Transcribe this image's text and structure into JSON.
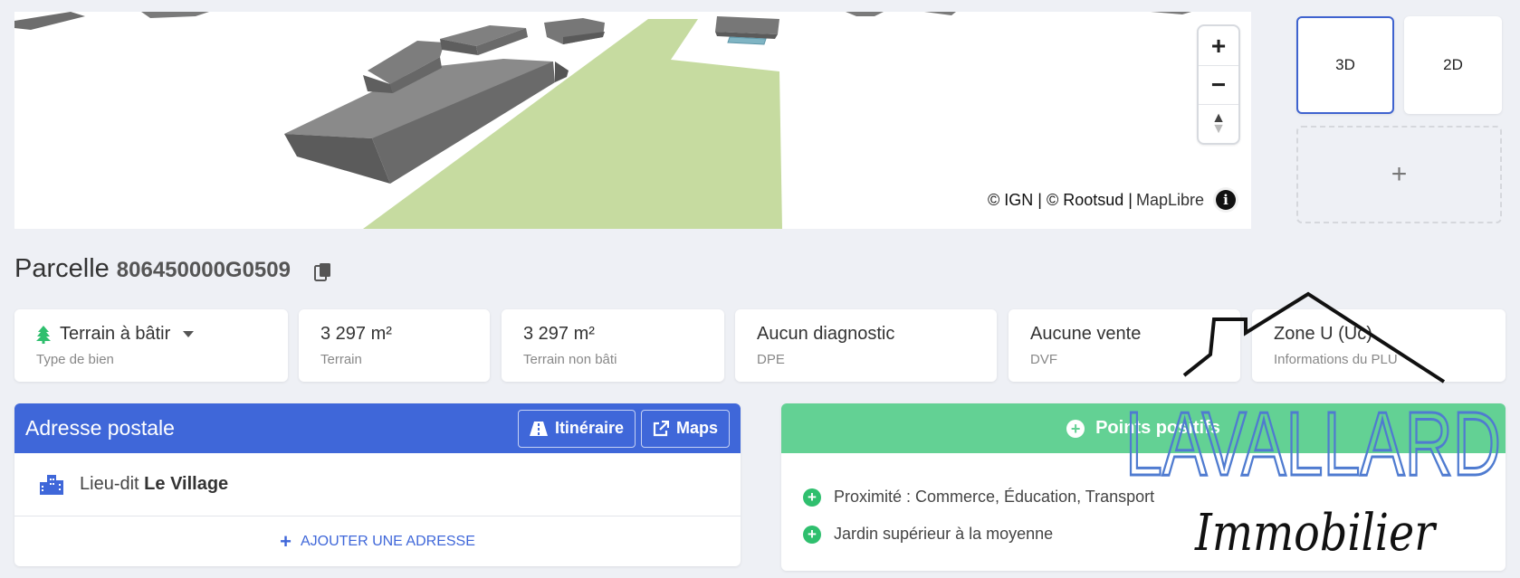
{
  "map": {
    "zoom_in": "+",
    "zoom_out": "−",
    "compass": "▲",
    "attribution_ign": "© IGN | © Rootsud |",
    "attribution_lib": "MapLibre",
    "info": "i"
  },
  "views": {
    "v3d": "3D",
    "v2d": "2D",
    "add": "+"
  },
  "parcel": {
    "prefix": "Parcelle",
    "id": "806450000G0509"
  },
  "cards": [
    {
      "value": "Terrain à bâtir",
      "label": "Type de bien"
    },
    {
      "value": "3 297 m²",
      "label": "Terrain"
    },
    {
      "value": "3 297 m²",
      "label": "Terrain non bâti"
    },
    {
      "value": "Aucun diagnostic",
      "label": "DPE"
    },
    {
      "value": "Aucune vente",
      "label": "DVF"
    },
    {
      "value": "Zone U (Uc)",
      "label": "Informations du PLU"
    }
  ],
  "address": {
    "title": "Adresse postale",
    "itinerary": "Itinéraire",
    "maps": "Maps",
    "prefix": "Lieu-dit",
    "place": "Le Village",
    "add_label": "AJOUTER UNE ADRESSE"
  },
  "positives": {
    "title": "Points positifs",
    "items": [
      "Proximité : Commerce, Éducation, Transport",
      "Jardin supérieur à la moyenne"
    ]
  },
  "logo": {
    "name": "LAVALLARD",
    "sub": "Immobilier"
  },
  "colors": {
    "primary": "#3f67d9",
    "positive": "#63d194",
    "parcel": "#c6dba0",
    "building": "#6f6f6f"
  }
}
